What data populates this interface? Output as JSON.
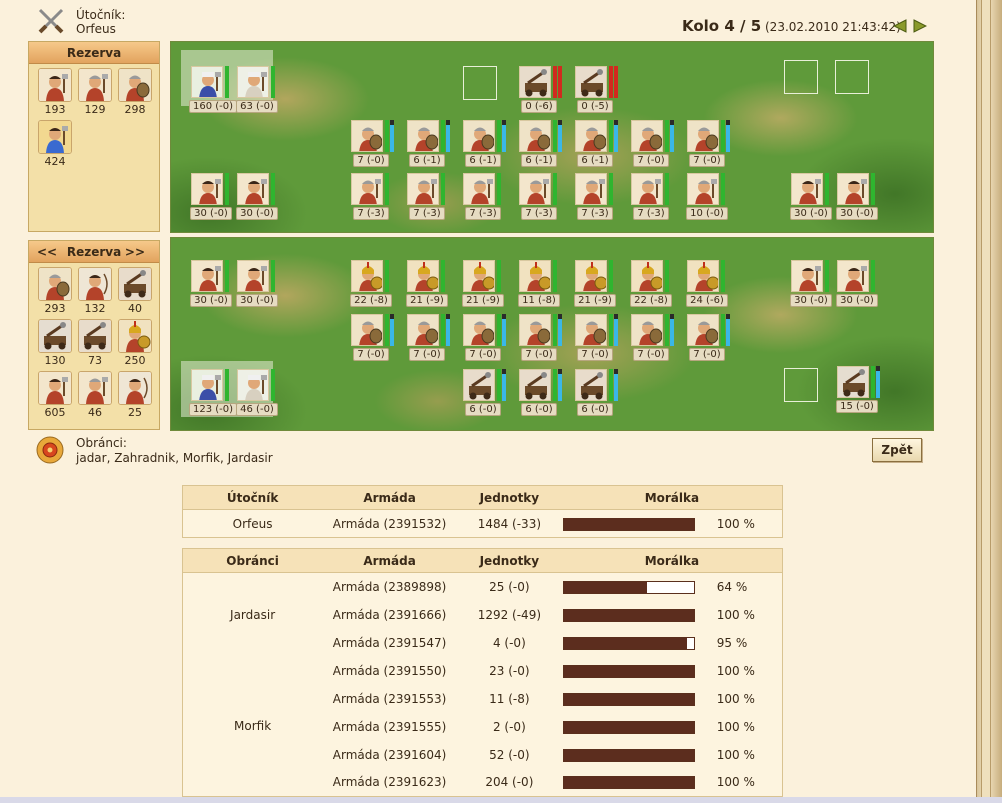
{
  "header": {
    "attacker_label": "Útočník:",
    "attacker_name": "Orfeus",
    "round": "Kolo 4 / 5",
    "date": "(23.02.2010 21:43:42)"
  },
  "reserve_attacker": {
    "title": "Rezerva",
    "items": [
      {
        "count": "193",
        "kind": "axeman"
      },
      {
        "count": "129",
        "kind": "warrior"
      },
      {
        "count": "298",
        "kind": "shieldman"
      },
      {
        "count": "424",
        "kind": "hero"
      }
    ]
  },
  "reserve_defender": {
    "title": "Rezerva",
    "prev": "<<",
    "next": ">>",
    "items": [
      {
        "count": "293",
        "kind": "shieldman"
      },
      {
        "count": "132",
        "kind": "archer"
      },
      {
        "count": "40",
        "kind": "catapult"
      },
      {
        "count": "130",
        "kind": "ballista"
      },
      {
        "count": "73",
        "kind": "catapult"
      },
      {
        "count": "250",
        "kind": "hoplite"
      },
      {
        "count": "605",
        "kind": "axeman"
      },
      {
        "count": "46",
        "kind": "warrior"
      },
      {
        "count": "25",
        "kind": "archer"
      }
    ]
  },
  "field_attacker": {
    "units": [
      {
        "count": "160 (-0)",
        "kind": "leader",
        "bars": [
          "green"
        ]
      },
      {
        "count": "63 (-0)",
        "kind": "leader2",
        "bars": [
          "green"
        ]
      },
      {
        "count": "0 (-6)",
        "kind": "catapult",
        "bars": [
          "red",
          "red"
        ]
      },
      {
        "count": "0 (-5)",
        "kind": "catapult",
        "bars": [
          "red",
          "red"
        ]
      },
      {
        "count": "7 (-0)",
        "kind": "shieldman",
        "bars": [
          "green",
          "blue"
        ]
      },
      {
        "count": "6 (-1)",
        "kind": "shieldman",
        "bars": [
          "green",
          "blue"
        ]
      },
      {
        "count": "6 (-1)",
        "kind": "shieldman",
        "bars": [
          "green",
          "blue"
        ]
      },
      {
        "count": "6 (-1)",
        "kind": "shieldman",
        "bars": [
          "green",
          "blue"
        ]
      },
      {
        "count": "6 (-1)",
        "kind": "shieldman",
        "bars": [
          "green",
          "blue"
        ]
      },
      {
        "count": "7 (-0)",
        "kind": "shieldman",
        "bars": [
          "green",
          "blue"
        ]
      },
      {
        "count": "7 (-0)",
        "kind": "shieldman",
        "bars": [
          "green",
          "blue"
        ]
      },
      {
        "count": "30 (-0)",
        "kind": "axeman",
        "bars": [
          "green"
        ]
      },
      {
        "count": "30 (-0)",
        "kind": "axeman",
        "bars": [
          "green"
        ]
      },
      {
        "count": "7 (-3)",
        "kind": "warrior",
        "bars": [
          "green"
        ]
      },
      {
        "count": "7 (-3)",
        "kind": "warrior",
        "bars": [
          "green"
        ]
      },
      {
        "count": "7 (-3)",
        "kind": "warrior",
        "bars": [
          "green"
        ]
      },
      {
        "count": "7 (-3)",
        "kind": "warrior",
        "bars": [
          "green"
        ]
      },
      {
        "count": "7 (-3)",
        "kind": "warrior",
        "bars": [
          "green"
        ]
      },
      {
        "count": "7 (-3)",
        "kind": "warrior",
        "bars": [
          "green"
        ]
      },
      {
        "count": "10 (-0)",
        "kind": "warrior",
        "bars": [
          "green"
        ]
      },
      {
        "count": "30 (-0)",
        "kind": "axeman",
        "bars": [
          "green"
        ]
      },
      {
        "count": "30 (-0)",
        "kind": "axeman",
        "bars": [
          "green"
        ]
      }
    ]
  },
  "field_defender": {
    "units": [
      {
        "count": "30 (-0)",
        "kind": "axeman",
        "bars": [
          "green"
        ]
      },
      {
        "count": "30 (-0)",
        "kind": "axeman",
        "bars": [
          "green"
        ]
      },
      {
        "count": "22 (-8)",
        "kind": "hoplite",
        "bars": [
          "green"
        ]
      },
      {
        "count": "21 (-9)",
        "kind": "hoplite",
        "bars": [
          "green"
        ]
      },
      {
        "count": "21 (-9)",
        "kind": "hoplite",
        "bars": [
          "green"
        ]
      },
      {
        "count": "11 (-8)",
        "kind": "hoplite",
        "bars": [
          "green"
        ]
      },
      {
        "count": "21 (-9)",
        "kind": "hoplite",
        "bars": [
          "green"
        ]
      },
      {
        "count": "22 (-8)",
        "kind": "hoplite",
        "bars": [
          "green"
        ]
      },
      {
        "count": "24 (-6)",
        "kind": "hoplite",
        "bars": [
          "green"
        ]
      },
      {
        "count": "30 (-0)",
        "kind": "axeman",
        "bars": [
          "green"
        ]
      },
      {
        "count": "30 (-0)",
        "kind": "axeman",
        "bars": [
          "green"
        ]
      },
      {
        "count": "7 (-0)",
        "kind": "shieldman",
        "bars": [
          "green",
          "blue"
        ]
      },
      {
        "count": "7 (-0)",
        "kind": "shieldman",
        "bars": [
          "green",
          "blue"
        ]
      },
      {
        "count": "7 (-0)",
        "kind": "shieldman",
        "bars": [
          "green",
          "blue"
        ]
      },
      {
        "count": "7 (-0)",
        "kind": "shieldman",
        "bars": [
          "green",
          "blue"
        ]
      },
      {
        "count": "7 (-0)",
        "kind": "shieldman",
        "bars": [
          "green",
          "blue"
        ]
      },
      {
        "count": "7 (-0)",
        "kind": "shieldman",
        "bars": [
          "green",
          "blue"
        ]
      },
      {
        "count": "7 (-0)",
        "kind": "shieldman",
        "bars": [
          "green",
          "blue"
        ]
      },
      {
        "count": "123 (-0)",
        "kind": "leader",
        "bars": [
          "green"
        ]
      },
      {
        "count": "46 (-0)",
        "kind": "leader2",
        "bars": [
          "green"
        ]
      },
      {
        "count": "6 (-0)",
        "kind": "catapult",
        "bars": [
          "green",
          "blue"
        ]
      },
      {
        "count": "6 (-0)",
        "kind": "catapult",
        "bars": [
          "green",
          "blue"
        ]
      },
      {
        "count": "6 (-0)",
        "kind": "catapult",
        "bars": [
          "green",
          "blue"
        ]
      },
      {
        "count": "15 (-0)",
        "kind": "ballista",
        "bars": [
          "green",
          "blue"
        ]
      }
    ]
  },
  "defenders": {
    "label": "Obránci:",
    "names": "jadar, Zahradnik, Morfik, Jardasir",
    "back_button": "Zpět"
  },
  "attacker_table": {
    "headers": [
      "Útočník",
      "Armáda",
      "Jednotky",
      "Morálka"
    ],
    "rows": [
      {
        "player": "Orfeus",
        "army": "Armáda (2391532)",
        "units": "1484 (-33)",
        "morale": 100,
        "morale_text": "100 %"
      }
    ]
  },
  "defender_table": {
    "headers": [
      "Obránci",
      "Armáda",
      "Jednotky",
      "Morálka"
    ],
    "groups": [
      {
        "player": "Jardasir",
        "rows": [
          {
            "army": "Armáda (2389898)",
            "units": "25 (-0)",
            "morale": 64,
            "morale_text": "64 %"
          },
          {
            "army": "Armáda (2391666)",
            "units": "1292 (-49)",
            "morale": 100,
            "morale_text": "100 %"
          },
          {
            "army": "Armáda (2391547)",
            "units": "4 (-0)",
            "morale": 95,
            "morale_text": "95 %"
          }
        ]
      },
      {
        "player": "Morfik",
        "rows": [
          {
            "army": "Armáda (2391550)",
            "units": "23 (-0)",
            "morale": 100,
            "morale_text": "100 %"
          },
          {
            "army": "Armáda (2391553)",
            "units": "11 (-8)",
            "morale": 100,
            "morale_text": "100 %"
          },
          {
            "army": "Armáda (2391555)",
            "units": "2 (-0)",
            "morale": 100,
            "morale_text": "100 %"
          },
          {
            "army": "Armáda (2391604)",
            "units": "52 (-0)",
            "morale": 100,
            "morale_text": "100 %"
          },
          {
            "army": "Armáda (2391623)",
            "units": "204 (-0)",
            "morale": 100,
            "morale_text": "100 %"
          }
        ]
      }
    ]
  },
  "colors": {
    "bar_green": "#2fb52f",
    "bar_red": "#d12a1e",
    "bar_blue": "#3ab7e8",
    "morale_fill": "#5c2d1e"
  }
}
